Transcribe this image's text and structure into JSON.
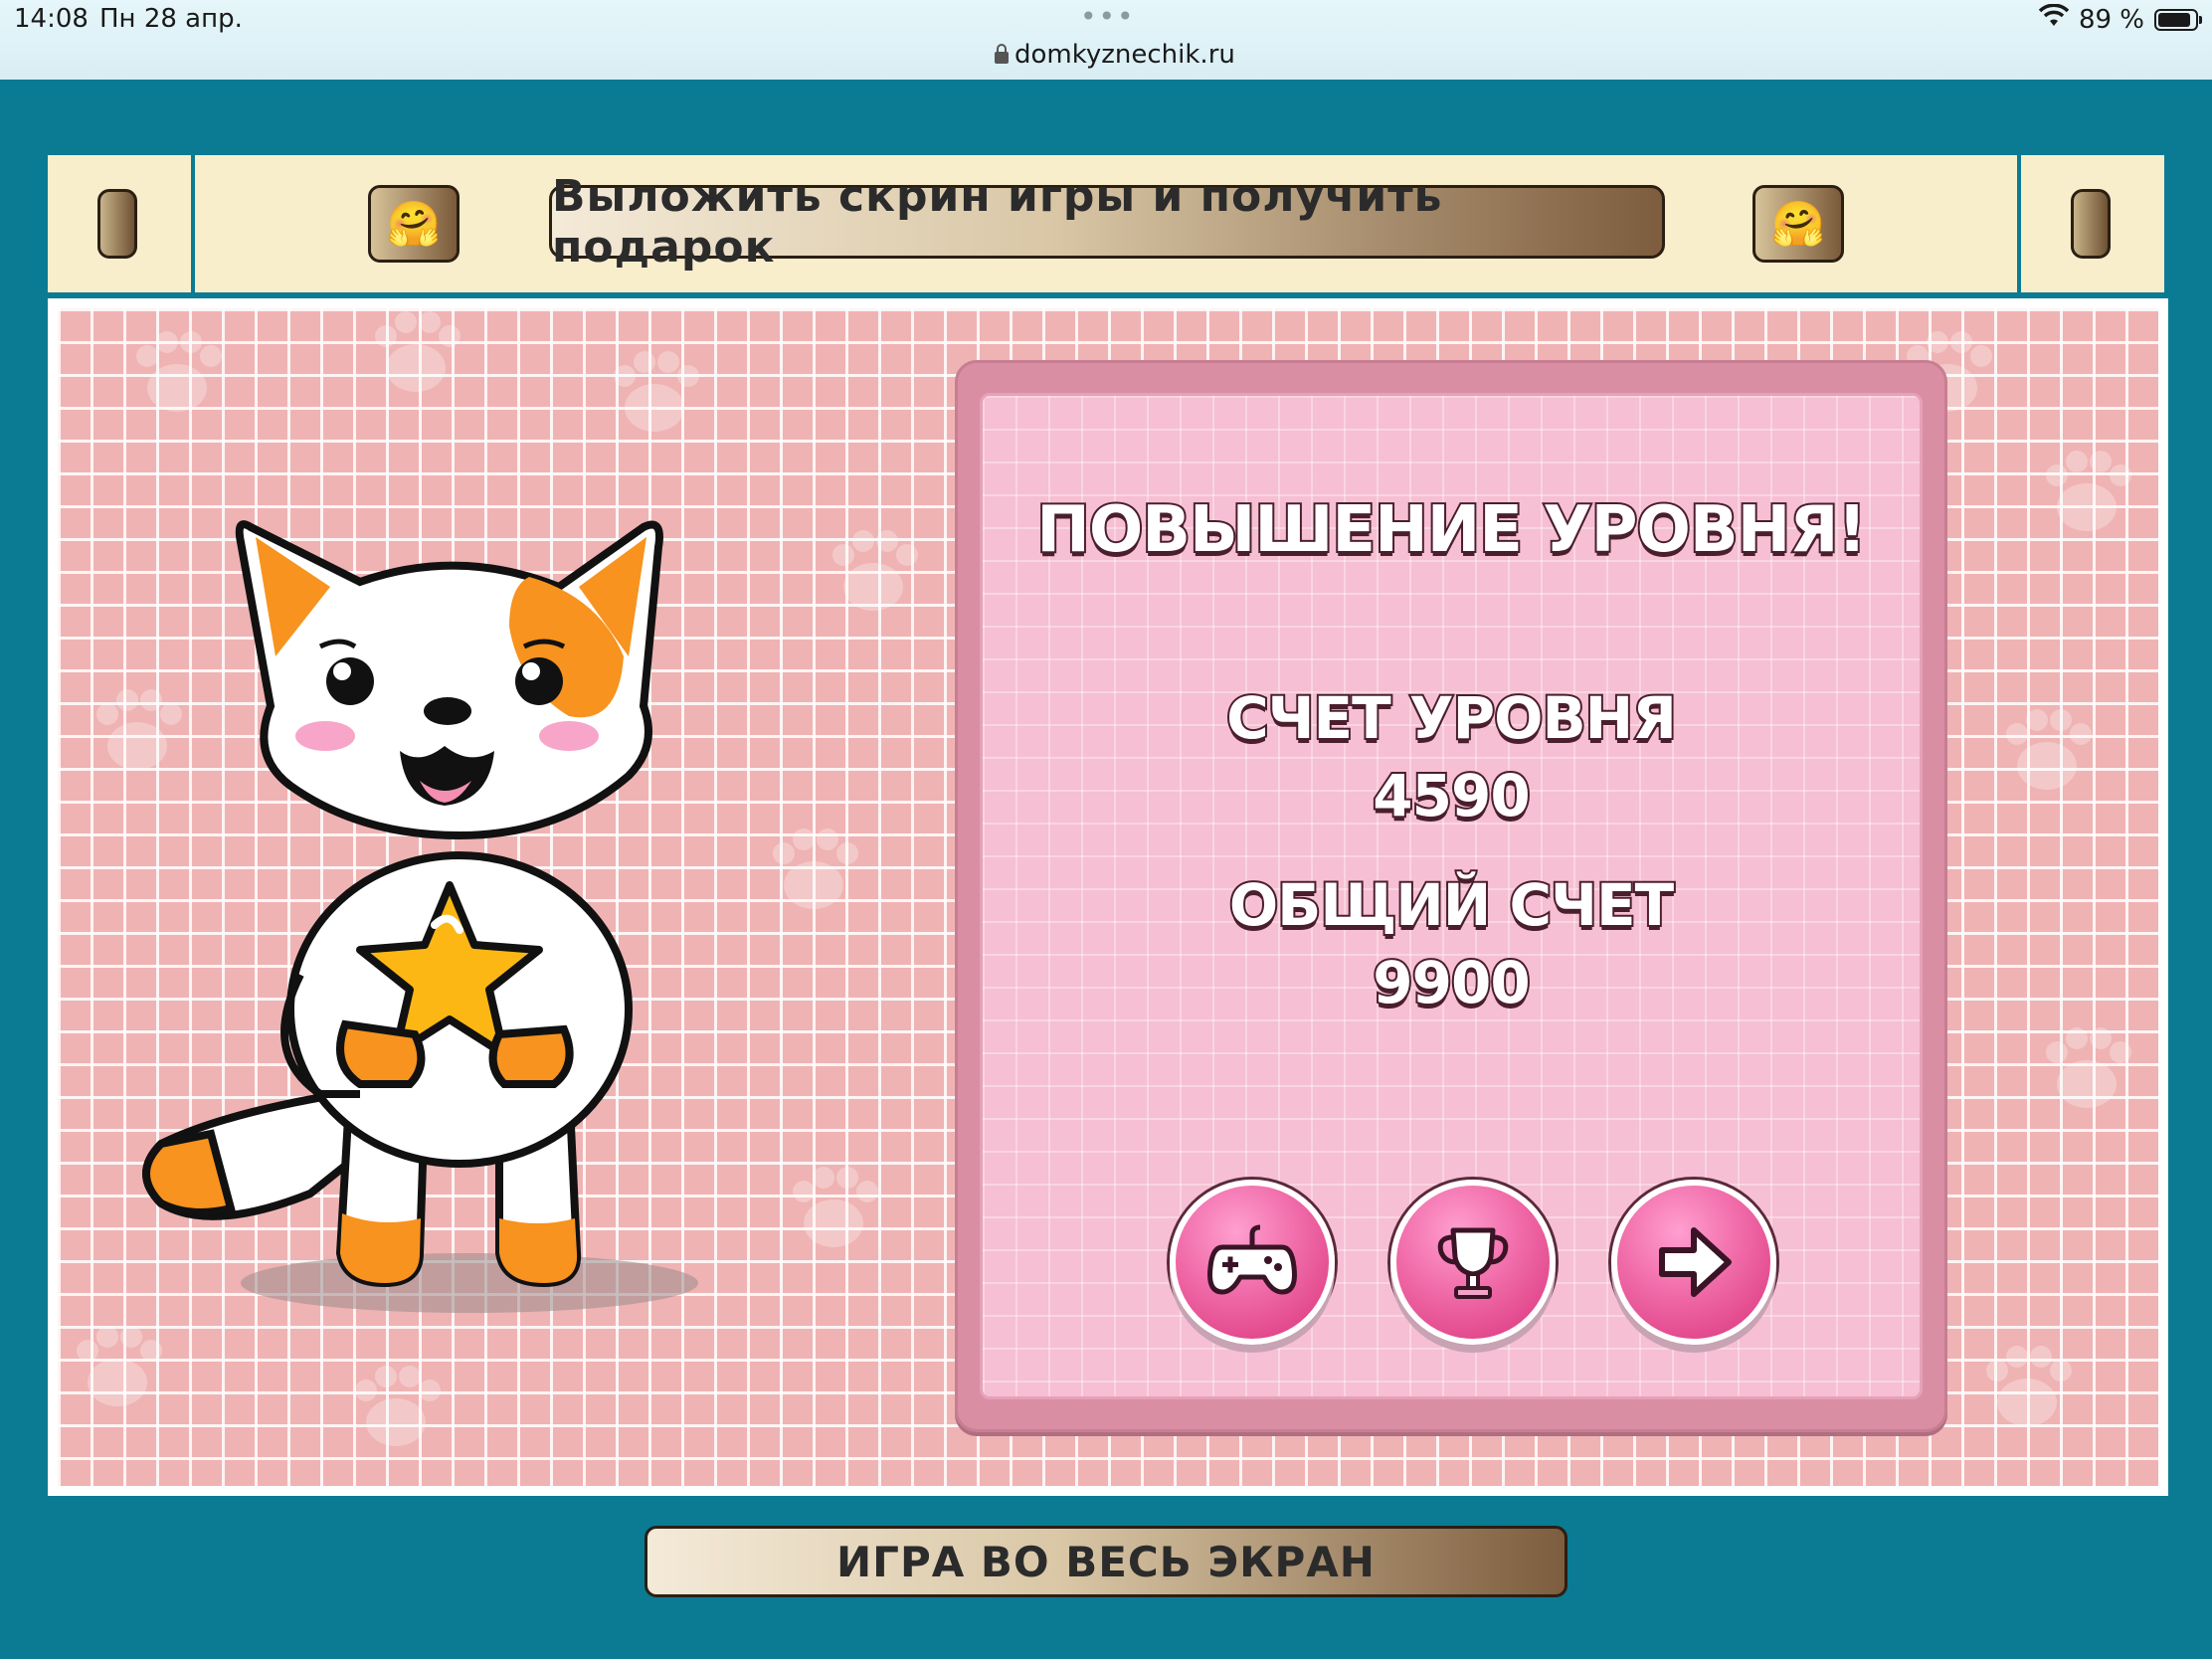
{
  "status_bar": {
    "time": "14:08",
    "date": "Пн 28 апр.",
    "url": "domkyznechik.ru",
    "battery": "89 %",
    "battery_level": 0.89
  },
  "banner": {
    "gift_label": "Выложить скрин игры и получить подарок",
    "emoji": "🤗"
  },
  "game": {
    "title": "ПОВЫШЕНИЕ УРОВНЯ!",
    "level_score_label": "СЧЕТ УРОВНЯ",
    "level_score_value": "4590",
    "total_score_label": "ОБЩИЙ СЧЕТ",
    "total_score_value": "9900",
    "buttons": [
      "gamepad-icon",
      "trophy-icon",
      "arrow-right-icon"
    ],
    "colors": {
      "background": "#efb3b3",
      "panel": "#f6bfd3",
      "button": "#f06aa8",
      "page": "#0b7b93"
    }
  },
  "footer": {
    "fullscreen_label": "ИГРА ВО ВЕСЬ ЭКРАН"
  }
}
